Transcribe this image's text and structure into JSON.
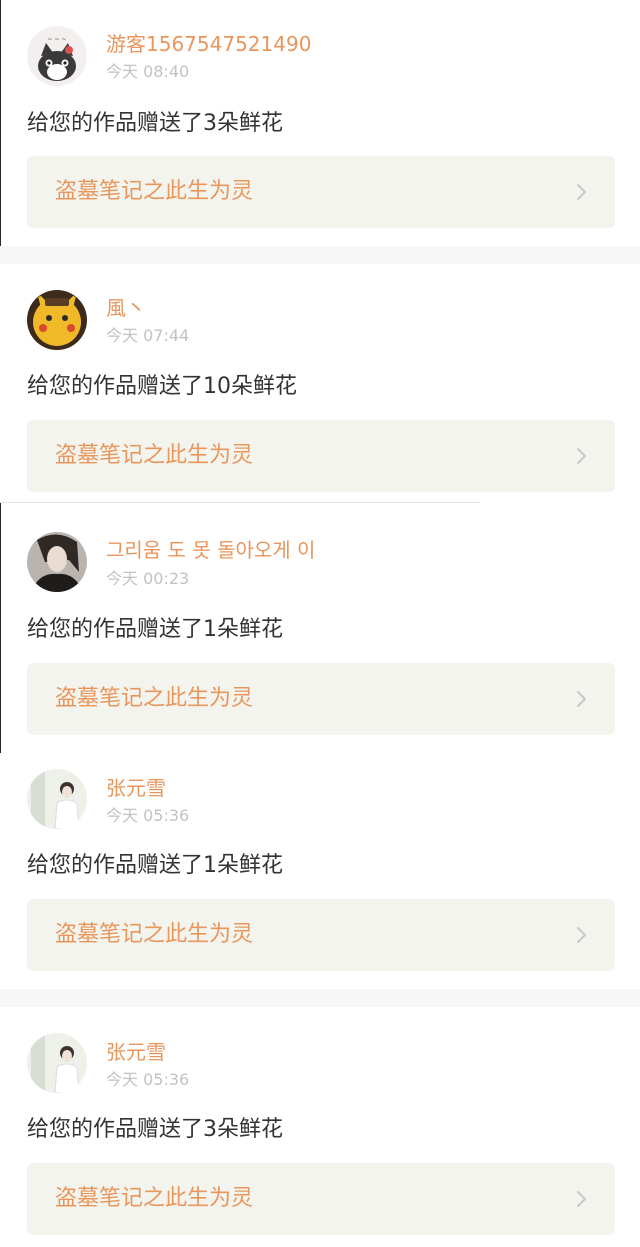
{
  "notifications": [
    {
      "username": "游客1567547521490",
      "time": "今天 08:40",
      "message": "给您的作品赠送了3朵鲜花",
      "work_title": "盗墓笔记之此生为灵",
      "avatar_icon": "cat-avatar-icon"
    },
    {
      "username": "風丶",
      "time": "今天 07:44",
      "message": "给您的作品赠送了10朵鲜花",
      "work_title": "盗墓笔记之此生为灵",
      "avatar_icon": "pikachu-avatar-icon"
    },
    {
      "username": "그리움 도 못 돌아오게 이",
      "time": "今天 00:23",
      "message": "给您的作品赠送了1朵鲜花",
      "work_title": "盗墓笔记之此生为灵",
      "avatar_icon": "portrait-avatar-icon"
    },
    {
      "username": "张元雪",
      "time": "今天 05:36",
      "message": "给您的作品赠送了1朵鲜花",
      "work_title": "盗墓笔记之此生为灵",
      "avatar_icon": "figure-avatar-icon"
    },
    {
      "username": "张元雪",
      "time": "今天 05:36",
      "message": "给您的作品赠送了3朵鲜花",
      "work_title": "盗墓笔记之此生为灵",
      "avatar_icon": "figure-avatar-icon"
    }
  ],
  "colors": {
    "accent": "#e8965c",
    "text": "#333333",
    "muted": "#c2c2c2",
    "link_background": "#f4f4ee",
    "separator": "#f7f7f7"
  }
}
